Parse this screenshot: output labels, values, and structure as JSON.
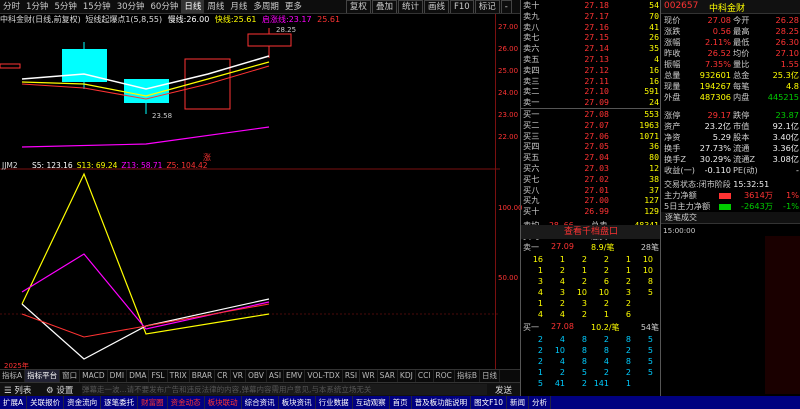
{
  "toolbar": {
    "items": [
      "分时",
      "1分钟",
      "5分钟",
      "15分钟",
      "30分钟",
      "60分钟",
      "日线",
      "周线",
      "月线",
      "多周期",
      "更多"
    ],
    "selected": "日线",
    "right_items": [
      "复权",
      "叠加",
      "统计",
      "画线",
      "F10",
      "标记",
      "-"
    ]
  },
  "info_line": {
    "stock": "中科金财(日线,前复权)",
    "indicator": "短线起爆点1(5,8,55)",
    "slow_label": "慢线:",
    "slow_value": "26.00",
    "fast_label": "快线:",
    "fast_value": "25.61",
    "mid_label": "启涨线:",
    "mid_value": "23.17",
    "top_value": "25.61"
  },
  "chart": {
    "price_labels": [
      "28.25",
      "23.58"
    ],
    "y_ticks": [
      "27.00",
      "26.00",
      "25.00",
      "24.00",
      "23.00",
      "22.00"
    ],
    "bottom_label": "2025年",
    "sub_indicator": {
      "name": "JJM2",
      "vals": [
        {
          "t": "S5: 123.16",
          "c": "#fff"
        },
        {
          "t": "S13: 69.24",
          "c": "#ff0"
        },
        {
          "t": "Z13: 58.71",
          "c": "#f0f"
        },
        {
          "t": "Z5: 104.42",
          "c": "#f33"
        }
      ]
    },
    "sub_ticks": [
      "100.00",
      "50.00"
    ]
  },
  "indicator_tabs": [
    "指标A",
    "指标平台",
    "窗口",
    "MACD",
    "DMI",
    "DMA",
    "FSL",
    "TRIX",
    "BRAR",
    "CR",
    "VR",
    "OBV",
    "ASI",
    "EMV",
    "VOL-TDX",
    "RSI",
    "WR",
    "SAR",
    "KDJ",
    "CCI",
    "ROC",
    "指标B",
    "日线"
  ],
  "cmdbar": {
    "list": "列表",
    "settings": "设置",
    "placeholder": "弹幕走一波...请不要发布广告和违反法律的内容,弹幕内容需用户意见,与本系统立场无关",
    "send": "发送"
  },
  "bottombar": [
    "扩展A",
    "关联报价",
    "资金流向",
    "逐笔委托",
    "财富圈",
    "资金动态",
    "板块联动",
    "综合资讯",
    "板块资讯",
    "行业数据",
    "互动观察",
    "首页",
    "普及板功能说明",
    "图文F10",
    "新闻",
    "分析"
  ],
  "orderbook": {
    "asks": [
      {
        "l": "卖十",
        "p": "27.18",
        "v": "54"
      },
      {
        "l": "卖九",
        "p": "27.17",
        "v": "70"
      },
      {
        "l": "卖八",
        "p": "27.16",
        "v": "41"
      },
      {
        "l": "卖七",
        "p": "27.15",
        "v": "26"
      },
      {
        "l": "卖六",
        "p": "27.14",
        "v": "35"
      },
      {
        "l": "卖五",
        "p": "27.13",
        "v": "4"
      },
      {
        "l": "卖四",
        "p": "27.12",
        "v": "16"
      },
      {
        "l": "卖三",
        "p": "27.11",
        "v": "16"
      },
      {
        "l": "卖二",
        "p": "27.10",
        "v": "591"
      },
      {
        "l": "卖一",
        "p": "27.09",
        "v": "24"
      }
    ],
    "bids": [
      {
        "l": "买一",
        "p": "27.08",
        "v": "553"
      },
      {
        "l": "买二",
        "p": "27.07",
        "v": "1963"
      },
      {
        "l": "买三",
        "p": "27.06",
        "v": "1071"
      },
      {
        "l": "买四",
        "p": "27.05",
        "v": "36"
      },
      {
        "l": "买五",
        "p": "27.04",
        "v": "80"
      },
      {
        "l": "买六",
        "p": "27.03",
        "v": "12"
      },
      {
        "l": "买七",
        "p": "27.02",
        "v": "38"
      },
      {
        "l": "买八",
        "p": "27.01",
        "v": "37"
      },
      {
        "l": "买九",
        "p": "27.00",
        "v": "127"
      },
      {
        "l": "买十",
        "p": "26.99",
        "v": "129"
      }
    ],
    "summary": [
      {
        "l": "卖均",
        "p": "28.66",
        "l2": "总卖",
        "v": "48341"
      },
      {
        "l": "买均",
        "p": "26.55",
        "l2": "总买",
        "v": "19763"
      }
    ],
    "link": "查看千档盘口"
  },
  "quote": {
    "code": "002657",
    "name": "中科金财",
    "rows": [
      [
        "现价",
        "27.08",
        "今开",
        "26.28"
      ],
      [
        "涨跌",
        "0.56",
        "最高",
        "28.25"
      ],
      [
        "涨幅",
        "2.11%",
        "最低",
        "26.30"
      ],
      [
        "昨收",
        "26.52",
        "均价",
        "27.10"
      ],
      [
        "振幅",
        "7.35%",
        "量比",
        "1.55"
      ],
      [
        "总量",
        "932601",
        "总金",
        "25.3亿"
      ],
      [
        "现量",
        "194267",
        "每笔",
        "4.8"
      ],
      [
        "外盘",
        "487306",
        "内盘",
        "445215"
      ]
    ],
    "rows2": [
      [
        "涨停",
        "29.17",
        "跌停",
        "23.87"
      ],
      [
        "资产",
        "23.2亿",
        "市值",
        "92.1亿"
      ],
      [
        "净资",
        "5.29",
        "股本",
        "3.40亿"
      ],
      [
        "换手",
        "27.73%",
        "流通",
        "3.36亿"
      ],
      [
        "换手Z",
        "30.29%",
        "流通Z",
        "3.08亿"
      ],
      [
        "收益(一)",
        "-0.110",
        "PE(动)",
        "-"
      ]
    ],
    "status_label": "交易状态:",
    "status": "闭市阶段",
    "time": "15:32:51",
    "flow": [
      {
        "l": "主力净额",
        "v": "3614万",
        "p": "1%"
      },
      {
        "l": "5日主力净额",
        "v": "-2643万",
        "p": "-1%"
      }
    ]
  },
  "level_panel": {
    "sell": {
      "l": "卖一",
      "p": "27.09",
      "v": "8.9/笔",
      "n": "28笔"
    },
    "sell_grid": [
      [
        "16",
        "1",
        "2",
        "2",
        "1",
        "10"
      ],
      [
        "1",
        "2",
        "1",
        "2",
        "1",
        "10"
      ],
      [
        "3",
        "4",
        "2",
        "6",
        "2",
        "8"
      ],
      [
        "4",
        "3",
        "10",
        "10",
        "3",
        "5"
      ],
      [
        "1",
        "2",
        "3",
        "2",
        "2",
        ""
      ],
      [
        "4",
        "4",
        "2",
        "1",
        "6",
        ""
      ]
    ],
    "buy": {
      "l": "买一",
      "p": "27.08",
      "v": "10.2/笔",
      "n": "54笔"
    },
    "buy_grid": [
      [
        "2",
        "4",
        "8",
        "2",
        "8",
        "5"
      ],
      [
        "2",
        "10",
        "8",
        "8",
        "2",
        "5"
      ],
      [
        "2",
        "4",
        "8",
        "4",
        "8",
        "5"
      ],
      [
        "1",
        "2",
        "5",
        "2",
        "2",
        "5"
      ],
      [
        "5",
        "41",
        "2",
        "141",
        "1",
        ""
      ]
    ]
  },
  "trades": {
    "title": "逐笔成交",
    "first_time": "15:00:00"
  }
}
